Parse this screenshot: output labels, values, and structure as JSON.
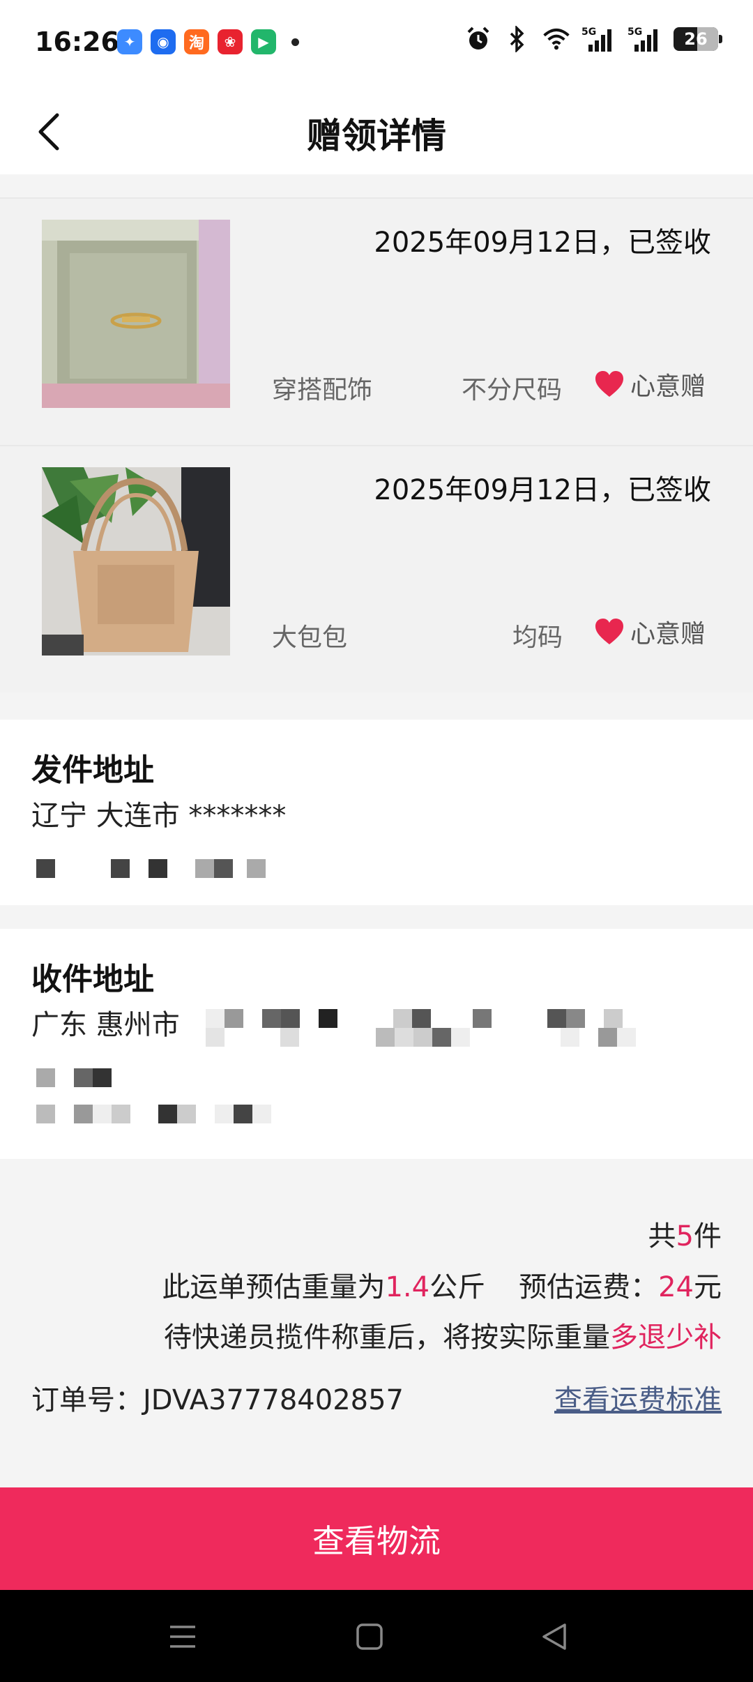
{
  "status_bar": {
    "time": "16:26",
    "battery_level": "26",
    "notification_apps": [
      {
        "name": "blue-bird-app-icon",
        "color": "#3d8bff",
        "glyph": "✦"
      },
      {
        "name": "chat-app-icon",
        "color": "#1e6cf0",
        "glyph": "◉"
      },
      {
        "name": "taobao-app-icon",
        "color": "#ff6a1f",
        "glyph": "淘"
      },
      {
        "name": "red-app-icon",
        "color": "#e8232f",
        "glyph": "❀"
      },
      {
        "name": "video-app-icon",
        "color": "#22b66b",
        "glyph": "▶"
      }
    ],
    "signal_labels": [
      "5G",
      "5G"
    ]
  },
  "header": {
    "title": "赠领详情"
  },
  "gifts": [
    {
      "date_status": "2025年09月12日，已签收",
      "category": "穿搭配饰",
      "size": "不分尺码",
      "badge": "心意赠",
      "image": "ring-in-box-photo"
    },
    {
      "date_status": "2025年09月12日，已签收",
      "category": "大包包",
      "size": "均码",
      "badge": "心意赠",
      "image": "tote-bag-photo"
    }
  ],
  "sender": {
    "title": "发件地址",
    "address": "辽宁 大连市 *******"
  },
  "receiver": {
    "title": "收件地址",
    "address": "广东 惠州市"
  },
  "summary": {
    "count_prefix": "共",
    "count": "5",
    "count_suffix": "件",
    "weight_prefix": "此运单预估重量为",
    "weight": "1.4",
    "weight_unit": "公斤",
    "fee_label": "预估运费：",
    "fee": "24",
    "fee_unit": "元",
    "note_prefix": "待快递员揽件称重后，将按实际重量",
    "note_highlight": "多退少补",
    "order_label": "订单号：",
    "order_number": "JDVA37778402857",
    "fee_standard_link": "查看运费标准"
  },
  "actions": {
    "logistics_button": "查看物流"
  },
  "colors": {
    "accent": "#e0245e",
    "button": "#ef2a5c",
    "link": "#4a5d87"
  }
}
